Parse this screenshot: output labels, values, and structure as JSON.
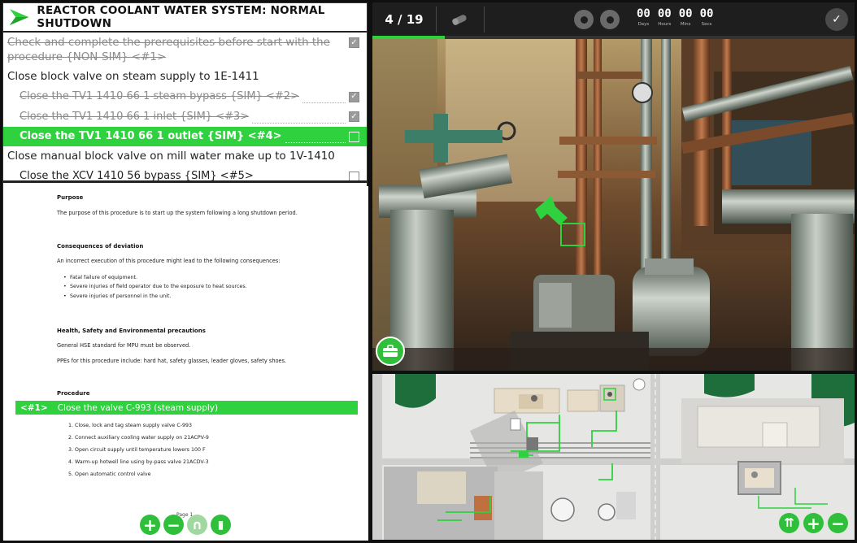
{
  "title": "REACTOR COOLANT WATER SYSTEM: NORMAL SHUTDOWN",
  "colors": {
    "accent": "#2fd13f",
    "topbar": "#1e1e1e"
  },
  "steps": [
    {
      "text": "Check and complete the prerequisites before start with the procedure  {NON-SIM}  <#1>",
      "level": 0,
      "status": "done"
    },
    {
      "text": "Close block valve on steam supply to 1E-1411",
      "level": 0,
      "status": "heading"
    },
    {
      "text": "Close the TV1 1410 66 1 steam bypass  {SIM}  <#2>",
      "level": 1,
      "status": "done"
    },
    {
      "text": "Close the TV1 1410 66 1 inlet  {SIM}  <#3>",
      "level": 1,
      "status": "done"
    },
    {
      "text": "Close the TV1 1410 66 1 outlet  {SIM}  <#4>",
      "level": 1,
      "status": "active"
    },
    {
      "text": "Close manual block valve on mill water make up to 1V-1410",
      "level": 0,
      "status": "heading"
    },
    {
      "text": "Close the XCV 1410 56 bypass  {SIM}  <#5>",
      "level": 1,
      "status": "todo"
    }
  ],
  "document": {
    "purpose_heading": "Purpose",
    "purpose_text": "The purpose of this procedure is to start up the system following a long shutdown period.",
    "consequences_heading": "Consequences of deviation",
    "consequences_text": "An incorrect execution of this procedure might lead to the following consequences:",
    "consequences_list": [
      "Fatal failure of equipment.",
      "Severe injuries of field operator due to the exposure to heat sources.",
      "Severe injuries of personnel in the unit."
    ],
    "hse_heading": "Health, Safety and Environmental precautions",
    "hse_text1": "General HSE standard for MPU must be observed.",
    "hse_text2": "PPEs for this procedure include: hard hat, safety glasses, leader gloves, safety shoes.",
    "procedure_heading": "Procedure",
    "procedure_bar_num": "<#1>",
    "procedure_bar_text": "Close the valve C-993 (steam supply)",
    "procedure_list": [
      "1.    Close, lock and tag steam supply valve C-993",
      "2.    Connect auxiliary cooling water supply on 21ACPV-9",
      "3.    Open circuit supply until temperature lowers 100 F",
      "4.    Warm-up hotwell line using by-pass valve 21ACDV-3",
      "5.    Open automatic control valve"
    ],
    "page_label": "Page 1"
  },
  "doc_tools": [
    {
      "name": "zoom-in",
      "icon": "plus-icon",
      "glyph": "+"
    },
    {
      "name": "zoom-out",
      "icon": "minus-icon",
      "glyph": "−"
    },
    {
      "name": "annotate",
      "icon": "pen-icon",
      "glyph": "∩"
    },
    {
      "name": "bookmark",
      "icon": "bookmark-icon",
      "glyph": "▮"
    }
  ],
  "topbar": {
    "step_counter": "4 / 19",
    "progress": 0.15,
    "timer": [
      {
        "value": "00",
        "label": "Days"
      },
      {
        "value": "00",
        "label": "Hours"
      },
      {
        "value": "00",
        "label": "Mins"
      },
      {
        "value": "00",
        "label": "Secs"
      }
    ]
  },
  "map_tools": [
    {
      "name": "layers",
      "icon": "layers-icon",
      "glyph": "⇈"
    },
    {
      "name": "map-zoom-in",
      "icon": "plus-icon",
      "glyph": "+"
    },
    {
      "name": "map-zoom-out",
      "icon": "minus-icon",
      "glyph": "−"
    }
  ]
}
